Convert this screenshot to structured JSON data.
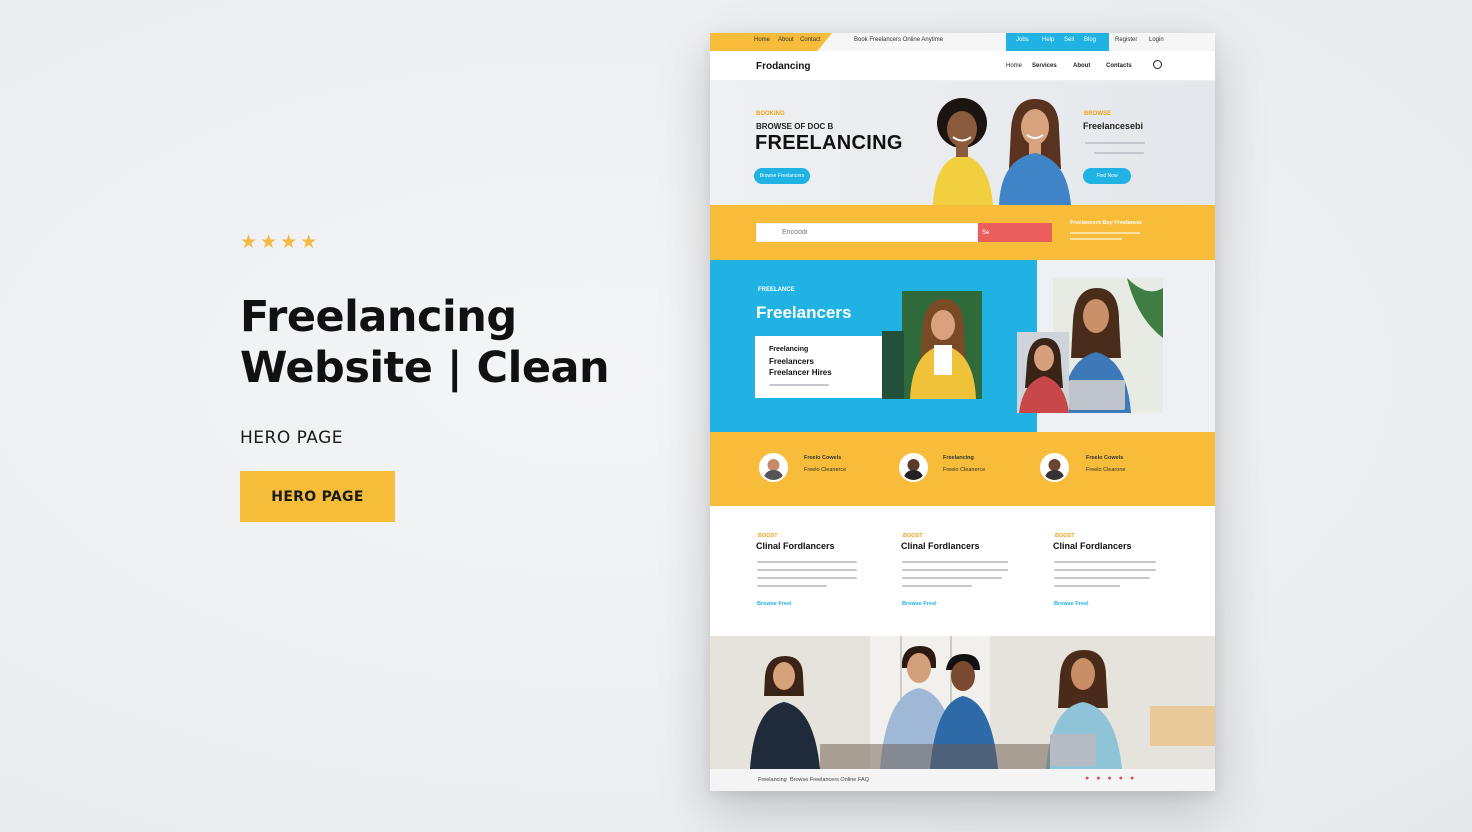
{
  "promo": {
    "stars": [
      "★",
      "★",
      "★",
      "★"
    ],
    "title_line1": "Freelancing",
    "title_line2": "Website | Clean",
    "subtitle": "HERO PAGE",
    "button_label": "HERO PAGE"
  },
  "mockup": {
    "topbar": {
      "left_items": [
        "Home",
        "About",
        "Contact"
      ],
      "center_text": "Book Freelancers Online Anytime",
      "right_items": [
        "Jobs",
        "Help",
        "Sell",
        "Blog"
      ],
      "account_items": [
        "Register",
        "Login"
      ]
    },
    "nav": {
      "logo": "Frodancing",
      "items": [
        "Home",
        "Services",
        "About",
        "Contacts"
      ]
    },
    "hero": {
      "kicker": "BOOKING",
      "line": "BROWSE OF DOC B",
      "title": "FREELANCING",
      "cta_label": "Browse Freelancers",
      "right_kicker": "BROWSE",
      "right_title": "Freelancesebi",
      "right_cta_label": "Find Now"
    },
    "search": {
      "placeholder": "Encoodi",
      "button_label": "Se",
      "right_label": "Freelancers Buy Freelancer"
    },
    "freelancers": {
      "kicker": "FREELANCE",
      "title": "Freelancers",
      "card_lines": [
        "Freelancing",
        "Freelancers",
        "Freelancer Hires"
      ]
    },
    "stats": [
      {
        "name": "Freelo Cowels",
        "value": "Freelo Cleanerce"
      },
      {
        "name": "Freelancing",
        "value": "Freelo Cleanerce"
      },
      {
        "name": "Freelo Cowels",
        "value": "Freelo Clearone"
      }
    ],
    "features": [
      {
        "kicker": "BOOST",
        "title": "Clinal Fordlancers",
        "link": "Browse Freel"
      },
      {
        "kicker": "BOOST",
        "title": "Clinal Fordlancers",
        "link": "Browse Freel"
      },
      {
        "kicker": "BOOST",
        "title": "Clinal Fordlancers",
        "link": "Browse Freel"
      }
    ],
    "footer": {
      "items": [
        "Freelancing",
        "Browse Freelancers Online",
        "FAQ"
      ]
    }
  },
  "colors": {
    "accent_yellow": "#f7bc3a",
    "accent_blue": "#1fb2e3",
    "accent_red": "#ea5d5d"
  }
}
